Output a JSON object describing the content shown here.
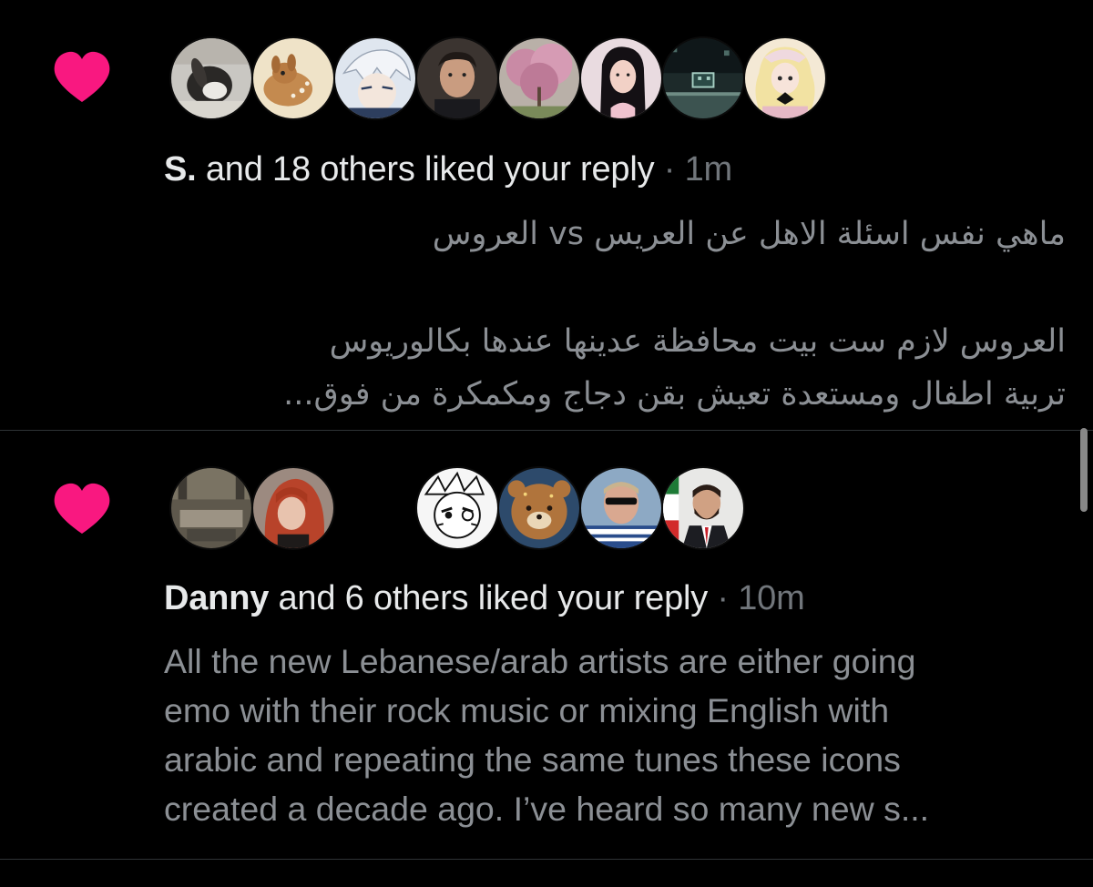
{
  "notifications": [
    {
      "icon": "heart-icon",
      "accent": "#f91880",
      "avatars": [
        "bunny-photo",
        "fawn-drawing",
        "anime-white-hair",
        "man-portrait",
        "cherry-blossom-tree",
        "woman-black-hair",
        "pixel-game",
        "lolita-doll"
      ],
      "name": "S.",
      "action": " and 18 others liked your reply",
      "separator": " · ",
      "time": "1m",
      "text_lines": [
        "ماهي نفس اسئلة الاهل عن العريس vs العروس",
        "",
        "العروس لازم ست بيت محافظة عدينها عندها بكالوريوس",
        "تربية اطفال ومستعدة تعيش بقن دجاج ومكمكرة من فوق..."
      ]
    },
    {
      "icon": "heart-icon",
      "accent": "#f91880",
      "avatars": [
        "room-interior",
        "red-hair-woman",
        "manga-face",
        "bear-toast",
        "sunglasses-man",
        "man-suit-flag"
      ],
      "name": "Danny",
      "action": " and 6 others liked your reply",
      "separator": " · ",
      "time": "10m",
      "text_lines": [
        "All the new Lebanese/arab artists are either going",
        "emo with their rock music or mixing English with",
        "arabic and repeating the same tunes these icons",
        "created a decade ago. I’ve heard so many new s..."
      ]
    }
  ]
}
